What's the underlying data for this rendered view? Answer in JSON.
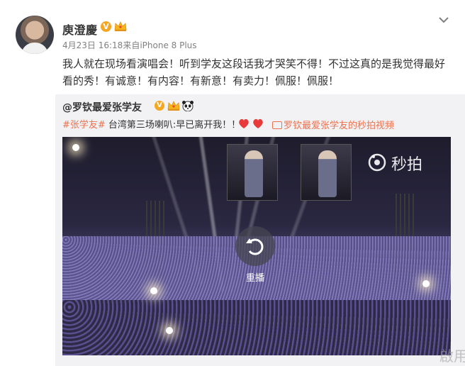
{
  "post": {
    "username": "庾澄慶",
    "vbadge": "V",
    "timestamp": "4月23日 16:18",
    "source_prefix": "来自",
    "source": "iPhone 8 Plus",
    "content": "我人就在现场看演唱会！听到学友这段话我才哭笑不得！不过这真的是我觉得最好看的秀！有诚意！有内容！有新意！有卖力！佩服！佩服！",
    "icons": {
      "menu": "chevron-down-icon",
      "crown": "crown-icon"
    }
  },
  "repost": {
    "username": "@罗钦最爱张学友",
    "vbadge": "V",
    "topic": "#张学友#",
    "text": " 台湾第三场喇叭:早已离开我！！",
    "video_link": "罗钦最爱张学友的秒拍视频",
    "icons": {
      "crown": "crown-icon",
      "panda": "panda-emoji-icon",
      "hearts": "heart-emoji-icon",
      "video": "video-camera-icon"
    }
  },
  "video": {
    "watermark": "秒拍",
    "replay_label": "重播",
    "icons": {
      "replay": "replay-icon",
      "watermark": "miaopai-logo-icon"
    }
  },
  "page_watermark": "啟用",
  "colors": {
    "accent": "#eb7350",
    "vbadge": "#f5a623",
    "meta": "#808080",
    "repost_bg": "#f2f2f5"
  }
}
